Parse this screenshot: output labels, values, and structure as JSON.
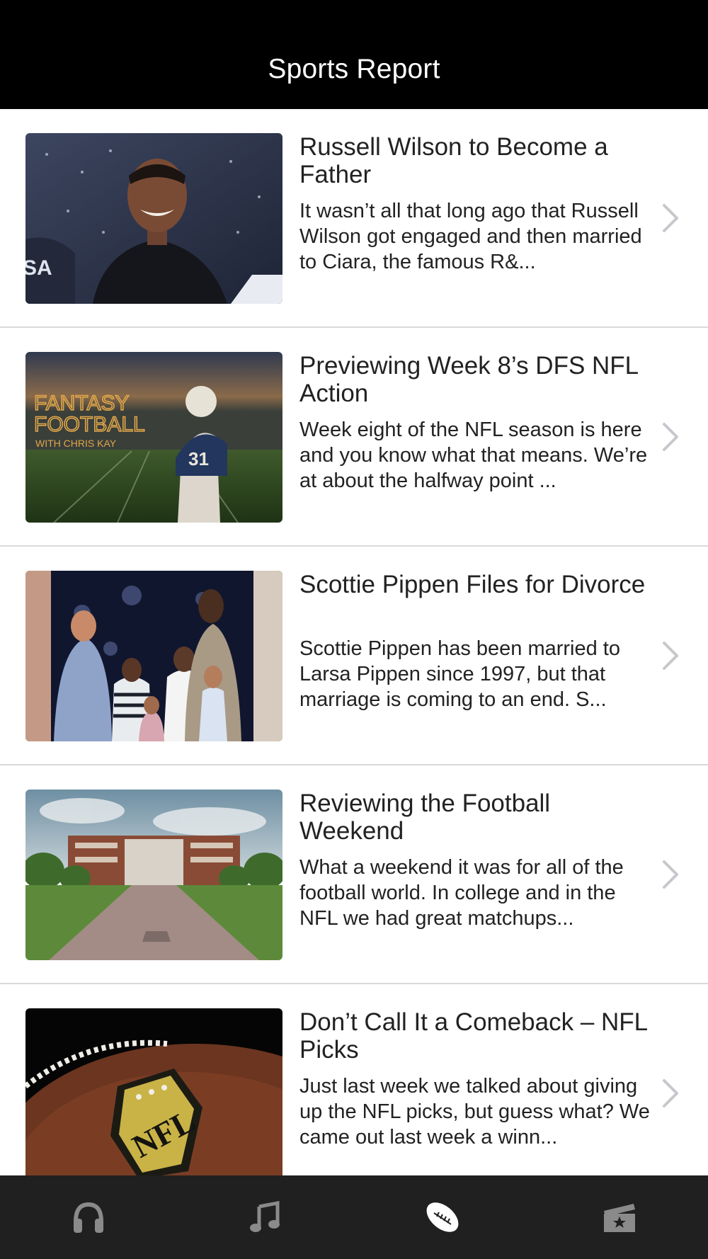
{
  "header": {
    "title": "Sports Report"
  },
  "articles": [
    {
      "title": "Russell Wilson to Become a Father",
      "summary": "It wasn’t all that long ago that Russell Wilson got engaged and then married to Ciara, the famous R&...",
      "image": "russell-wilson-photo"
    },
    {
      "title": "Previewing Week 8’s DFS NFL Action",
      "summary": "Week eight of the NFL season is here and you know what that means. We’re at about the halfway point ...",
      "image": "fantasy-football-photo",
      "image_text": [
        "FANTASY",
        "FOOTBALL",
        "WITH CHRIS KAY"
      ]
    },
    {
      "title": "Scottie Pippen Files for Divorce",
      "summary": "Scottie Pippen has been married to Larsa Pippen since 1997, but that marriage is coming to an end. S...",
      "image": "pippen-family-photo"
    },
    {
      "title": "Reviewing the Football Weekend",
      "summary": "What a weekend it was for all of the football world. In college and in the NFL we had great matchups...",
      "image": "stadium-photo"
    },
    {
      "title": "Don’t Call It a Comeback – NFL Picks",
      "summary": "Just last week we talked about giving up the NFL picks, but guess what? We came out last week a winn...",
      "image": "nfl-football-photo",
      "image_text": [
        "NFL"
      ]
    }
  ],
  "tabbar": {
    "tabs": [
      {
        "icon": "headphones-icon",
        "selected": false
      },
      {
        "icon": "music-note-icon",
        "selected": false
      },
      {
        "icon": "football-icon",
        "selected": true
      },
      {
        "icon": "ticket-star-icon",
        "selected": false
      }
    ]
  },
  "colors": {
    "navbar_bg": "#000000",
    "tabbar_bg": "#202020",
    "tab_icon": "#8a8a8a",
    "tab_icon_selected": "#ffffff",
    "separator": "#d9d9d9",
    "chevron": "#c7c7cc"
  }
}
